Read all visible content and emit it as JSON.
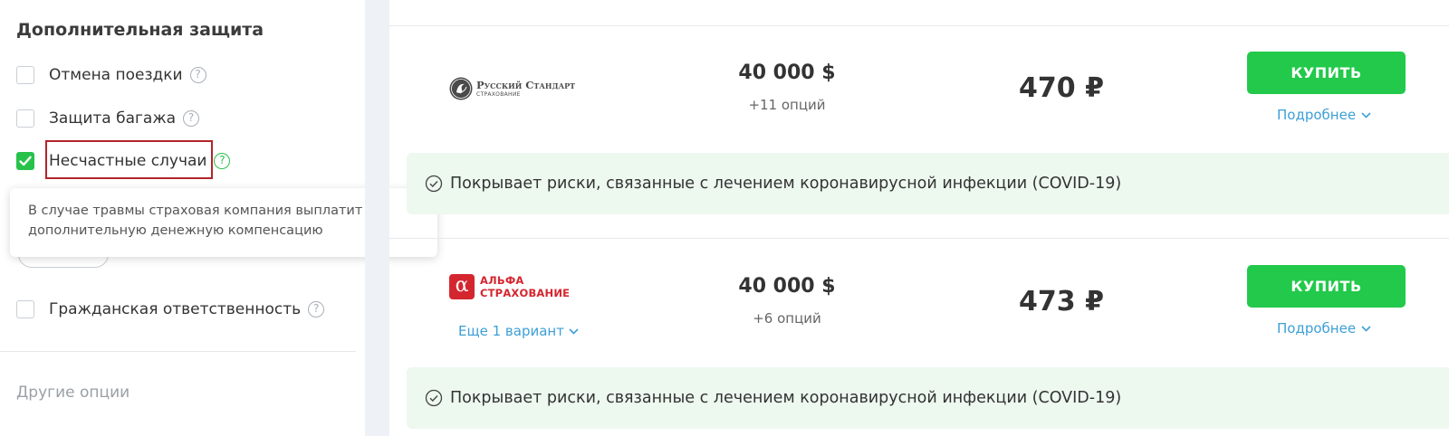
{
  "sidebar": {
    "title": "Дополнительная защита",
    "options": [
      {
        "label": "Отмена поездки",
        "checked": false
      },
      {
        "label": "Защита багажа",
        "checked": false
      },
      {
        "label": "Несчастные случаи",
        "checked": true
      },
      {
        "label": "Гражданская ответственность",
        "checked": false
      }
    ],
    "tooltip": {
      "line1": "В случае травмы страховая компания выплатит",
      "line2": "дополнительную денежную компенсацию"
    },
    "other_options": "Другие опции"
  },
  "offers": [
    {
      "company_logo_text": {
        "line1": "Русский Стандарт",
        "line2": "СТРАХОВАНИЕ"
      },
      "coverage": "40 000 $",
      "options": "+11 опций",
      "price": "470 ₽",
      "buy_label": "КУПИТЬ",
      "more_label": "Подробнее",
      "covid_text": "Покрывает риски, связанные с лечением коронавирусной инфекции (COVID-19)"
    },
    {
      "company_logo_text": {
        "mark": "α",
        "line1": "АЛЬФА",
        "line2": "СТРАХОВАНИЕ"
      },
      "coverage": "40 000 $",
      "options": "+6 опций",
      "price": "473 ₽",
      "buy_label": "КУПИТЬ",
      "more_label": "Подробнее",
      "variants_label": "Еще 1 вариант",
      "covid_text": "Покрывает риски, связанные с лечением коронавирусной инфекции (COVID-19)"
    }
  ],
  "colors": {
    "accent_green": "#22c94a",
    "link_blue": "#3d9fd6",
    "covid_bg": "#edf8ef",
    "highlight_red": "#b3242a",
    "alfa_red": "#d4262f"
  },
  "icons": [
    "question-icon",
    "checkmark-icon",
    "chevron-down-icon",
    "check-circle-icon"
  ]
}
